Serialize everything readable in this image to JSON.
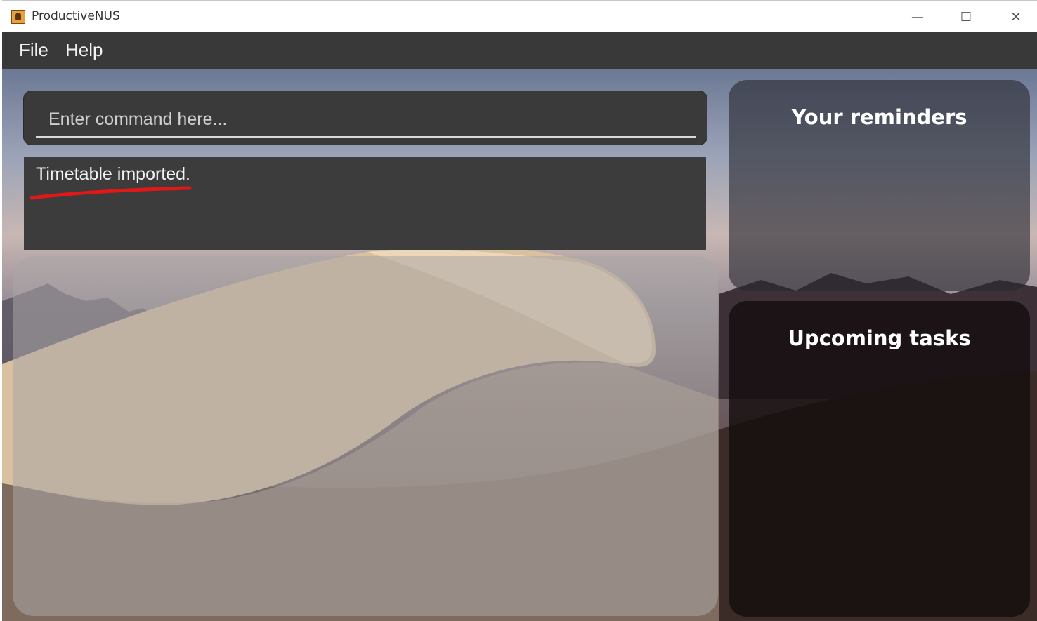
{
  "window": {
    "title": "ProductiveNUS",
    "minimize": "—",
    "maximize": "☐",
    "close": "✕"
  },
  "menu": {
    "items": [
      "File",
      "Help"
    ]
  },
  "command": {
    "placeholder": "Enter command here..."
  },
  "result": {
    "message": "Timetable imported."
  },
  "panels": {
    "reminders_title": "Your reminders",
    "tasks_title": "Upcoming tasks"
  },
  "colors": {
    "menubar": "#393939",
    "command_box": "#3a3a3a",
    "underline_annotation": "#e01818"
  }
}
